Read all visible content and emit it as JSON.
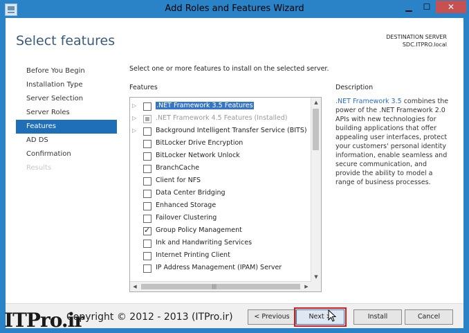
{
  "window": {
    "title": "Add Roles and Features Wizard",
    "buttons": {
      "minimize": "▁",
      "maximize": "☐",
      "close": "✕"
    }
  },
  "page": {
    "heading": "Select features",
    "destination_label": "DESTINATION SERVER",
    "destination_server": "SDC.ITPRO.local"
  },
  "nav": {
    "items": [
      {
        "label": "Before You Begin",
        "state": "normal"
      },
      {
        "label": "Installation Type",
        "state": "normal"
      },
      {
        "label": "Server Selection",
        "state": "normal"
      },
      {
        "label": "Server Roles",
        "state": "normal"
      },
      {
        "label": "Features",
        "state": "active"
      },
      {
        "label": "AD DS",
        "state": "normal"
      },
      {
        "label": "Confirmation",
        "state": "normal"
      },
      {
        "label": "Results",
        "state": "disabled"
      }
    ]
  },
  "main": {
    "instruction": "Select one or more features to install on the selected server.",
    "features_label": "Features",
    "description_label": "Description",
    "features": [
      {
        "label": ".NET Framework 3.5 Features",
        "expandable": true,
        "checked": false,
        "selected": true,
        "disabled": false
      },
      {
        "label": ".NET Framework 4.5 Features (Installed)",
        "expandable": true,
        "checked": "indeterminate",
        "selected": false,
        "disabled": true
      },
      {
        "label": "Background Intelligent Transfer Service (BITS)",
        "expandable": true,
        "checked": false,
        "selected": false,
        "disabled": false
      },
      {
        "label": "BitLocker Drive Encryption",
        "expandable": false,
        "checked": false,
        "selected": false,
        "disabled": false
      },
      {
        "label": "BitLocker Network Unlock",
        "expandable": false,
        "checked": false,
        "selected": false,
        "disabled": false
      },
      {
        "label": "BranchCache",
        "expandable": false,
        "checked": false,
        "selected": false,
        "disabled": false
      },
      {
        "label": "Client for NFS",
        "expandable": false,
        "checked": false,
        "selected": false,
        "disabled": false
      },
      {
        "label": "Data Center Bridging",
        "expandable": false,
        "checked": false,
        "selected": false,
        "disabled": false
      },
      {
        "label": "Enhanced Storage",
        "expandable": false,
        "checked": false,
        "selected": false,
        "disabled": false
      },
      {
        "label": "Failover Clustering",
        "expandable": false,
        "checked": false,
        "selected": false,
        "disabled": false
      },
      {
        "label": "Group Policy Management",
        "expandable": false,
        "checked": true,
        "selected": false,
        "disabled": false
      },
      {
        "label": "Ink and Handwriting Services",
        "expandable": false,
        "checked": false,
        "selected": false,
        "disabled": false
      },
      {
        "label": "Internet Printing Client",
        "expandable": false,
        "checked": false,
        "selected": false,
        "disabled": false
      },
      {
        "label": "IP Address Management (IPAM) Server",
        "expandable": false,
        "checked": false,
        "selected": false,
        "disabled": false
      }
    ],
    "description": {
      "link": ".NET Framework 3.5",
      "text": " combines the power of the .NET Framework 2.0 APIs with new technologies for building applications that offer appealing user interfaces, protect your customers' personal identity information, enable seamless and secure communication, and provide the ability to model a range of business processes."
    }
  },
  "footer": {
    "previous": "< Previous",
    "next": "Next >",
    "install": "Install",
    "cancel": "Cancel"
  },
  "watermark": {
    "logo": "ITPro.ir",
    "text": "Copyright © 2012 - 2013 (ITPro.ir)"
  },
  "colors": {
    "titlebar": "#2b83c7",
    "nav_active": "#1f6fb8",
    "highlight_box": "#d31c1c",
    "link": "#2a6ebb"
  }
}
